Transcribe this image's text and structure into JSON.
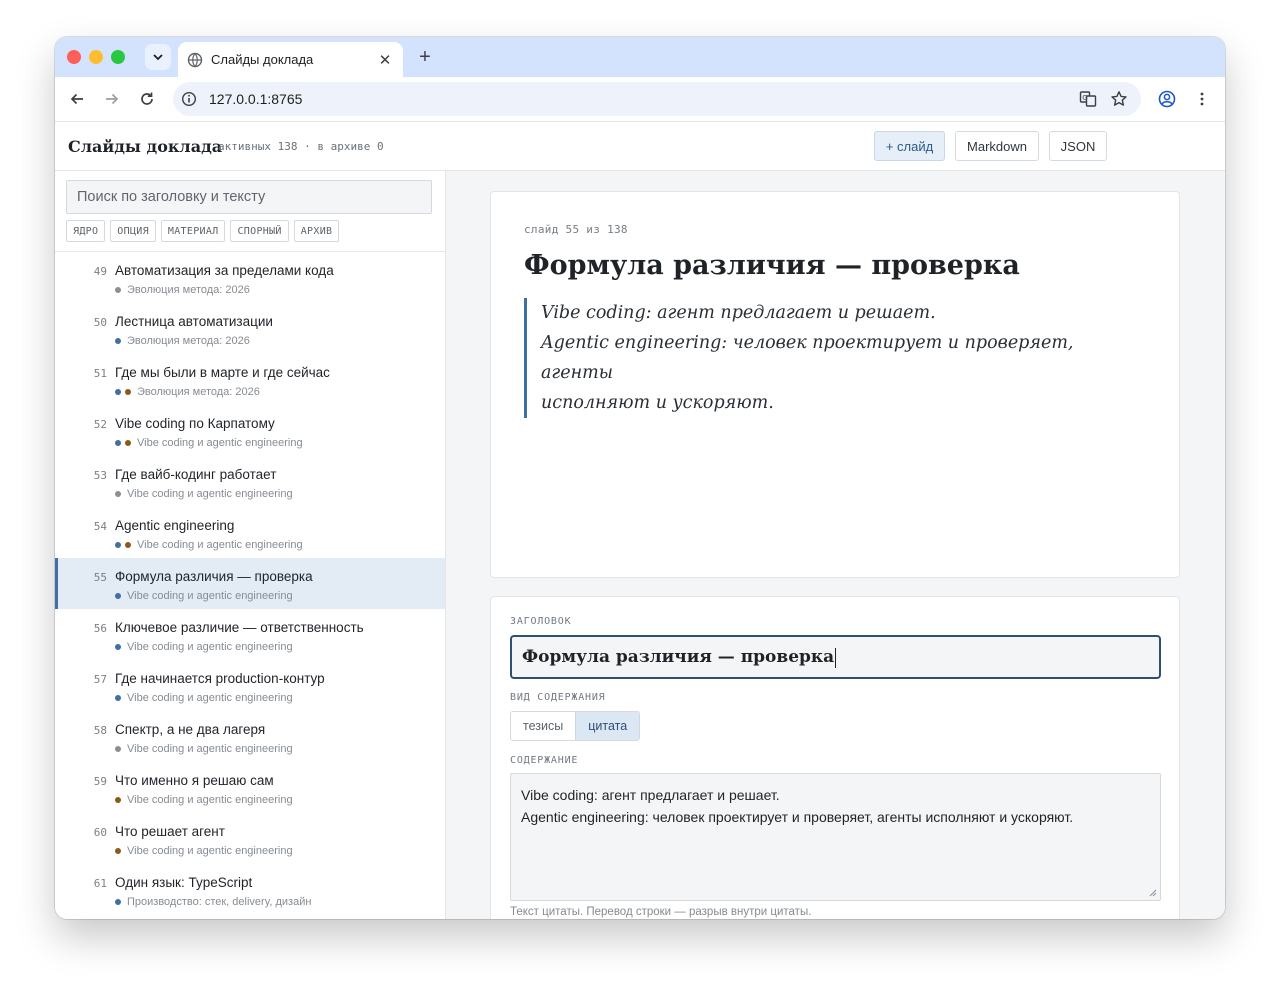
{
  "browser": {
    "tab_title": "Слайды доклада",
    "url": "127.0.0.1:8765"
  },
  "app": {
    "title": "Слайды доклада",
    "stats": "активных 138 · в архиве 0",
    "buttons": {
      "add_slide": "+ слайд",
      "markdown": "Markdown",
      "json": "JSON"
    }
  },
  "sidebar": {
    "search_placeholder": "Поиск по заголовку и тексту",
    "filters": [
      "ЯДРО",
      "ОПЦИЯ",
      "МАТЕРИАЛ",
      "СПОРНЫЙ",
      "АРХИВ"
    ],
    "tag_colors": {
      "core": "#3f6fa3",
      "option": "#8a5a1c",
      "material": "#8a8f96"
    },
    "items": [
      {
        "num": "49",
        "title": "Автоматизация за пределами кода",
        "section": "Эволюция метода: 2026",
        "tags": [
          "material"
        ]
      },
      {
        "num": "50",
        "title": "Лестница автоматизации",
        "section": "Эволюция метода: 2026",
        "tags": [
          "core"
        ]
      },
      {
        "num": "51",
        "title": "Где мы были в марте и где сейчас",
        "section": "Эволюция метода: 2026",
        "tags": [
          "core",
          "option"
        ]
      },
      {
        "num": "52",
        "title": "Vibe coding по Карпатому",
        "section": "Vibe coding и agentic engineering",
        "tags": [
          "core",
          "option"
        ]
      },
      {
        "num": "53",
        "title": "Где вайб-кодинг работает",
        "section": "Vibe coding и agentic engineering",
        "tags": [
          "material"
        ]
      },
      {
        "num": "54",
        "title": "Agentic engineering",
        "section": "Vibe coding и agentic engineering",
        "tags": [
          "core",
          "option"
        ]
      },
      {
        "num": "55",
        "title": "Формула различия — проверка",
        "section": "Vibe coding и agentic engineering",
        "tags": [
          "core"
        ],
        "active": true
      },
      {
        "num": "56",
        "title": "Ключевое различие — ответственность",
        "section": "Vibe coding и agentic engineering",
        "tags": [
          "core"
        ]
      },
      {
        "num": "57",
        "title": "Где начинается production-контур",
        "section": "Vibe coding и agentic engineering",
        "tags": [
          "core"
        ]
      },
      {
        "num": "58",
        "title": "Спектр, а не два лагеря",
        "section": "Vibe coding и agentic engineering",
        "tags": [
          "material"
        ]
      },
      {
        "num": "59",
        "title": "Что именно я решаю сам",
        "section": "Vibe coding и agentic engineering",
        "tags": [
          "option"
        ]
      },
      {
        "num": "60",
        "title": "Что решает агент",
        "section": "Vibe coding и agentic engineering",
        "tags": [
          "option"
        ]
      },
      {
        "num": "61",
        "title": "Один язык: TypeScript",
        "section": "Производство: стек, delivery, дизайн",
        "tags": [
          "core"
        ]
      }
    ]
  },
  "preview": {
    "meta": "слайд 55 из 138",
    "title": "Формула различия — проверка",
    "quote_lines": [
      "Vibe coding: агент предлагает и решает.",
      "Agentic engineering: человек проектирует и проверяет, агенты",
      "исполняют и ускоряют."
    ]
  },
  "editor": {
    "title_label": "ЗАГОЛОВОК",
    "title_value": "Формула различия — проверка",
    "kind_label": "ВИД СОДЕРЖАНИЯ",
    "kind_options": [
      "тезисы",
      "цитата"
    ],
    "kind_selected": "цитата",
    "content_label": "СОДЕРЖАНИЕ",
    "content_lines": [
      "Vibe coding: агент предлагает и решает.",
      "Agentic engineering: человек проектирует и проверяет, агенты исполняют и ускоряют."
    ],
    "hint": "Текст цитаты. Перевод строки — разрыв внутри цитаты."
  }
}
